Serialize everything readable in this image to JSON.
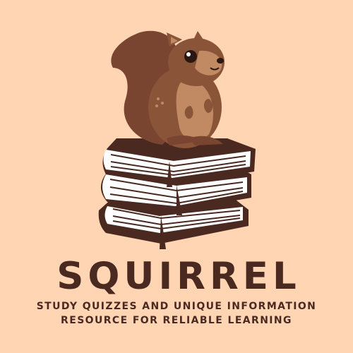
{
  "brand": {
    "name": "SQUIRREL",
    "tagline_line1": "STUDY QUIZZES AND UNIQUE INFORMATION",
    "tagline_line2": "RESOURCE FOR RELIABLE LEARNING"
  },
  "icons": {
    "mascot": "squirrel-icon",
    "base": "book-stack-icon"
  },
  "colors": {
    "background": "#ffd5b4",
    "dark_brown": "#4a2a20",
    "squirrel_body": "#8a5438",
    "squirrel_tail": "#7a4530",
    "squirrel_belly": "#c18a63",
    "book_pages": "#ffffff"
  }
}
